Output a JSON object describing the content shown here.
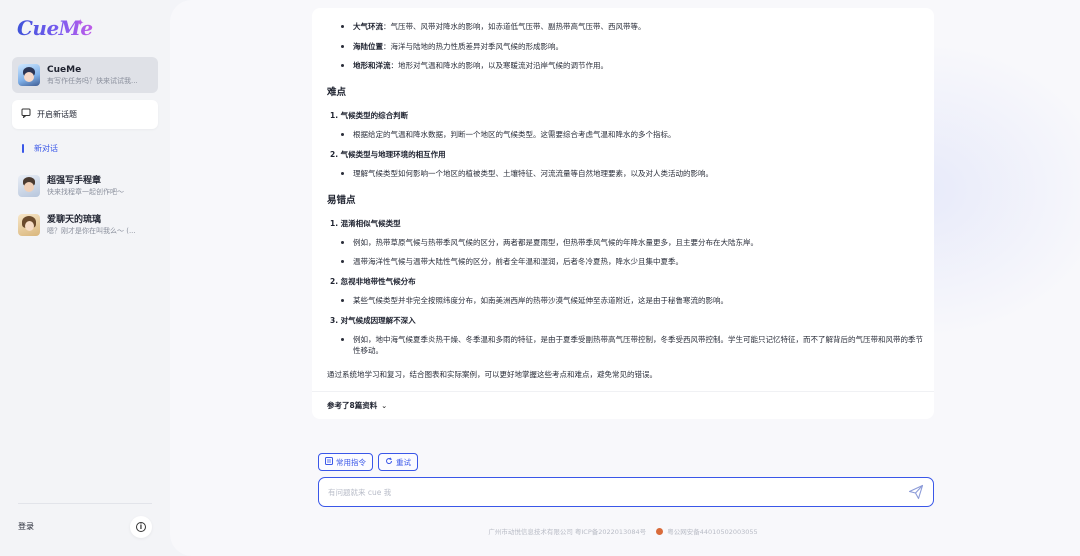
{
  "app": {
    "logo": "CueMe",
    "logo_mark": "✦"
  },
  "sidebar": {
    "chats": [
      {
        "name": "CueMe",
        "subtitle": "有写作任务吗？快来试试我..."
      },
      {
        "name": "超强写手程章",
        "subtitle": "快来找程章一起创作吧～"
      },
      {
        "name": "爱聊天的琉璃",
        "subtitle": "嗯？刚才是你在叫我么～ (..."
      }
    ],
    "new_topic_label": "开启新话题",
    "new_chat_section": "新对话",
    "login_label": "登录",
    "info_icon": "info-icon"
  },
  "answer": {
    "top_bullets": [
      {
        "term": "大气环流",
        "text": "：气压带、风带对降水的影响，如赤道低气压带、副热带高气压带、西风带等。"
      },
      {
        "term": "海陆位置",
        "text": "：海洋与陆地的热力性质差异对季风气候的形成影响。"
      },
      {
        "term": "地形和洋流",
        "text": "：地形对气温和降水的影响，以及寒暖流对沿岸气候的调节作用。"
      }
    ],
    "difficulties_heading": "难点",
    "difficulties": [
      {
        "title": "1. 气候类型的综合判断",
        "bullets": [
          "根据给定的气温和降水数据，判断一个地区的气候类型。这需要综合考虑气温和降水的多个指标。"
        ]
      },
      {
        "title": "2. 气候类型与地理环境的相互作用",
        "bullets": [
          "理解气候类型如何影响一个地区的植被类型、土壤特征、河流流量等自然地理要素，以及对人类活动的影响。"
        ]
      }
    ],
    "mistakes_heading": "易错点",
    "mistakes": [
      {
        "title": "1. 混淆相似气候类型",
        "bullets": [
          "例如，热带草原气候与热带季风气候的区分，两者都是夏雨型，但热带季风气候的年降水量更多，且主要分布在大陆东岸。",
          "温带海洋性气候与温带大陆性气候的区分，前者全年温和湿润，后者冬冷夏热，降水少且集中夏季。"
        ]
      },
      {
        "title": "2. 忽视非地带性气候分布",
        "bullets": [
          "某些气候类型并非完全按照纬度分布，如南美洲西岸的热带沙漠气候延伸至赤道附近，这是由于秘鲁寒流的影响。"
        ]
      },
      {
        "title": "3. 对气候成因理解不深入",
        "bullets": [
          "例如，地中海气候夏季炎热干燥、冬季温和多雨的特征，是由于夏季受副热带高气压带控制，冬季受西风带控制。学生可能只记忆特征，而不了解背后的气压带和风带的季节性移动。"
        ]
      }
    ],
    "conclusion": "通过系统地学习和复习，结合图表和实际案例，可以更好地掌握这些考点和难点，避免常见的错误。",
    "references_label": "参考了8篇资料"
  },
  "actions": {
    "common_commands": "常用指令",
    "retry": "重试"
  },
  "input": {
    "placeholder": "有问题就来 cue 我"
  },
  "footer": {
    "company": "广州市动悦信息技术有限公司 粤ICP备2022013084号",
    "police": "粤公网安备44010502003055"
  },
  "colors": {
    "accent": "#3a57e8",
    "sidebar_bg": "#f3f4f7",
    "main_bg": "#f8f8fb"
  }
}
